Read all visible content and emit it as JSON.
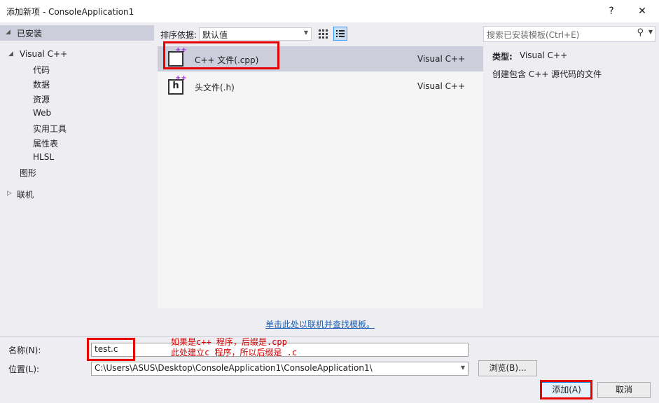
{
  "window": {
    "title": "添加新项 - ConsoleApplication1",
    "help": "?",
    "close": "✕"
  },
  "tree": {
    "installed": "已安装",
    "visualcpp": "Visual C++",
    "children": [
      "代码",
      "数据",
      "资源",
      "Web",
      "实用工具",
      "属性表",
      "HLSL"
    ],
    "graphics": "图形",
    "online": "联机"
  },
  "sort": {
    "label": "排序依据:",
    "value": "默认值"
  },
  "templates": [
    {
      "name": "C++ 文件(.cpp)",
      "type": "Visual C++"
    },
    {
      "name": "头文件(.h)",
      "type": "Visual C++"
    }
  ],
  "search": {
    "placeholder": "搜索已安装模板(Ctrl+E)"
  },
  "details": {
    "type_label": "类型:",
    "type_value": "Visual C++",
    "description": "创建包含 C++ 源代码的文件"
  },
  "online_link": "单击此处以联机并查找模板。",
  "form": {
    "name_label": "名称(N):",
    "name_value": "test.c",
    "location_label": "位置(L):",
    "location_value": "C:\\Users\\ASUS\\Desktop\\ConsoleApplication1\\ConsoleApplication1\\",
    "browse": "浏览(B)...",
    "add": "添加(A)",
    "cancel": "取消"
  },
  "annotation": {
    "line1": "如果是c++ 程序，后缀是.cpp",
    "line2": "此处建立c 程序，所以后缀是 .c"
  },
  "colors": {
    "annotation_red": "#e60000",
    "selection": "#cccedb",
    "link": "#1a5fb4"
  }
}
